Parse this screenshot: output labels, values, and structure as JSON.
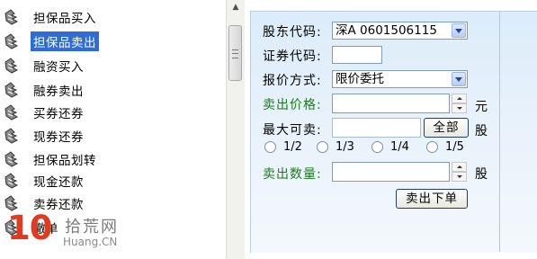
{
  "tree": {
    "items": [
      {
        "label": "担保品买入"
      },
      {
        "label": "担保品卖出"
      },
      {
        "label": "融资买入"
      },
      {
        "label": "融券卖出"
      },
      {
        "label": "买券还券"
      },
      {
        "label": "现券还券"
      },
      {
        "label": "担保品划转"
      },
      {
        "label": "现金还款"
      },
      {
        "label": "卖券还款"
      },
      {
        "label": "撤单"
      }
    ],
    "selected_index": 1
  },
  "form": {
    "shareholder_code_label": "股东代码:",
    "shareholder_code_value": "深A 0601506115",
    "security_code_label": "证券代码:",
    "security_code_value": "",
    "quote_method_label": "报价方式:",
    "quote_method_value": "限价委托",
    "sell_price_label": "卖出价格:",
    "sell_price_value": "",
    "price_unit": "元",
    "max_sellable_label": "最大可卖:",
    "max_sellable_value": "",
    "all_button": "全部",
    "share_unit": "股",
    "fraction_options": [
      "1/2",
      "1/3",
      "1/4",
      "1/5"
    ],
    "sell_qty_label": "卖出数量:",
    "sell_qty_value": "",
    "qty_unit": "股",
    "submit_button": "卖出下单"
  },
  "watermark": {
    "number": "10",
    "name": "拾荒网",
    "url": "Huang.CN"
  },
  "colors": {
    "selection": "#2f6cd6",
    "green_label": "#1c7a1c",
    "watermark_red": "#e23a1f",
    "panel_bg": "#dcecfa"
  }
}
